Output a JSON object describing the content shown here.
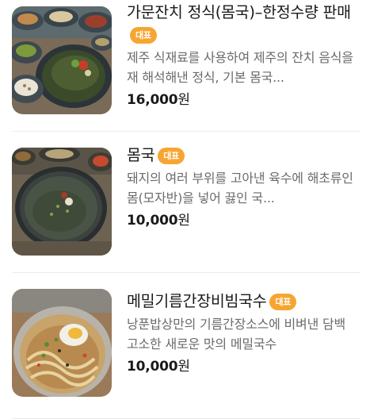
{
  "menu": {
    "items": [
      {
        "name": "가문잔치 정식(몸국)–한정수량 판매",
        "badge": "대표",
        "description": "제주 식재료를 사용하여 제주의 잔치 음식을 재 해석해낸 정식, 기본 몸국...",
        "price_amount": "16,000",
        "price_unit": "원",
        "image_icon": "food-photo-jeongsik"
      },
      {
        "name": "몸국",
        "badge": "대표",
        "description": "돼지의 여러 부위를 고아낸 육수에 해초류인 몸(모자반)을 넣어 끓인 국...",
        "price_amount": "10,000",
        "price_unit": "원",
        "image_icon": "food-photo-momguk"
      },
      {
        "name": "메밀기름간장비빔국수",
        "badge": "대표",
        "description": "낭푼밥상만의 기름간장소스에 비벼낸 담백 고소한 새로운 맛의 메밀국수",
        "price_amount": "10,000",
        "price_unit": "원",
        "image_icon": "food-photo-bibimguksu"
      }
    ]
  }
}
